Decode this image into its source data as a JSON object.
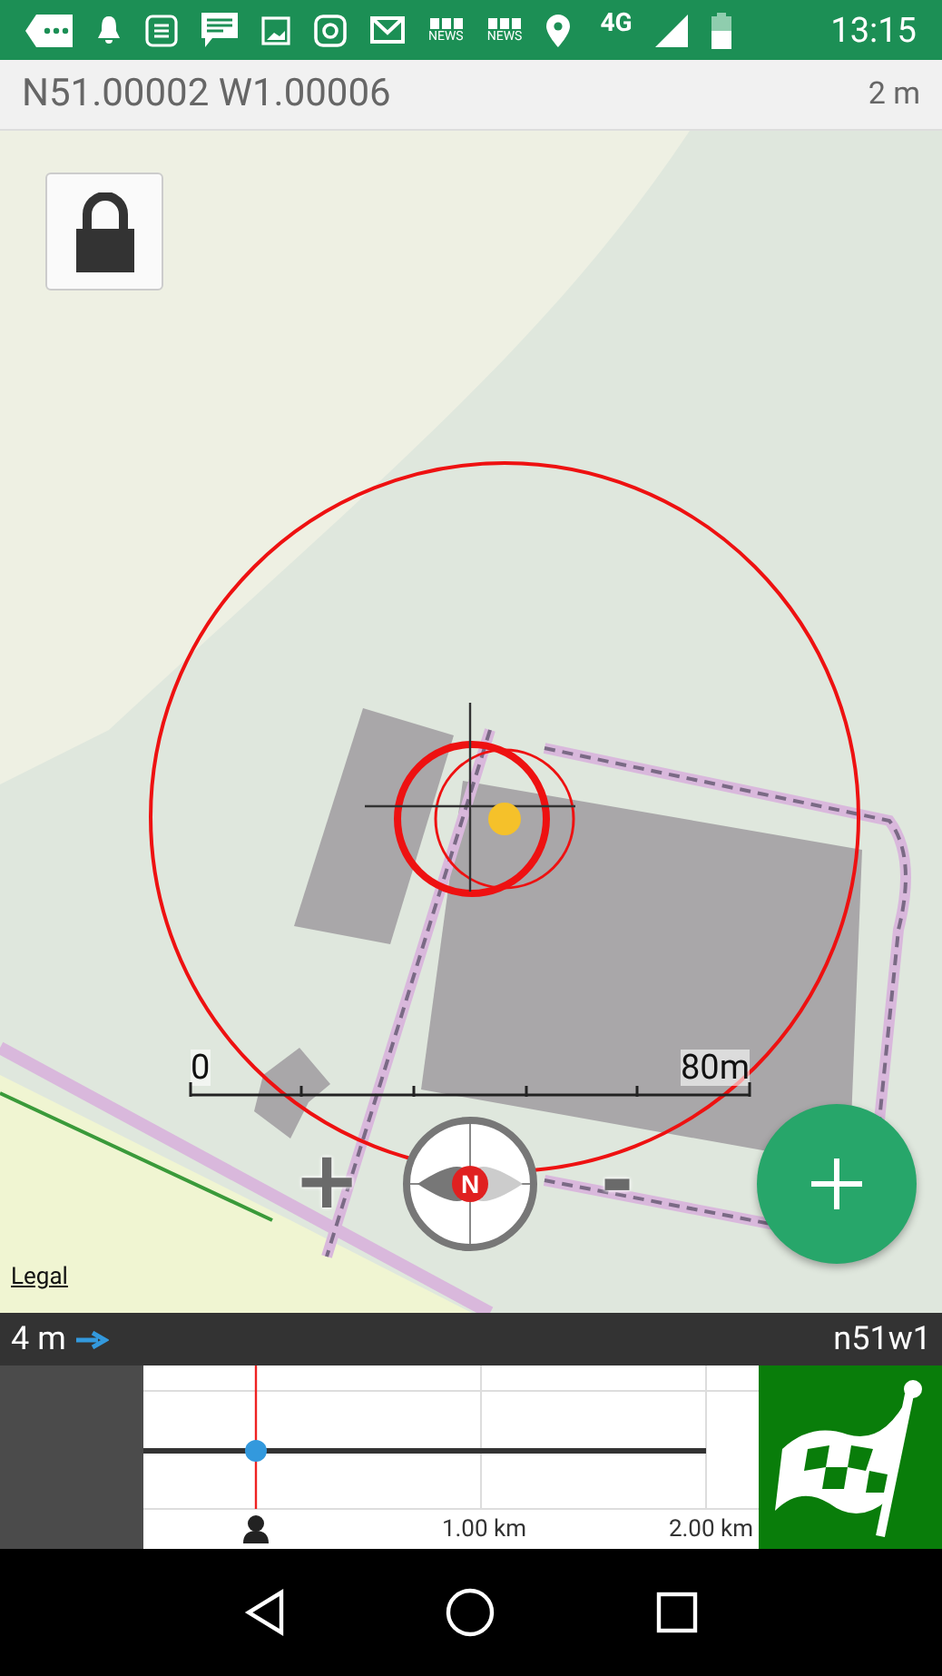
{
  "status_bar": {
    "news_labels": [
      "NEWS",
      "NEWS"
    ],
    "network": "4G",
    "time": "13:15"
  },
  "header": {
    "coordinates": "N51.00002 W1.00006",
    "accuracy": "2 m"
  },
  "map": {
    "kind": "picture",
    "locked": true,
    "scale_bar": {
      "start": "0",
      "end": "80m"
    },
    "zoom_in": "+",
    "compass": "N",
    "zoom_out": "-",
    "legal": "Legal"
  },
  "info_bar": {
    "distance": "4 m",
    "waypoint": "n51w1"
  },
  "profile": {
    "ticks": [
      "1.00 km",
      "2.00 km"
    ]
  }
}
